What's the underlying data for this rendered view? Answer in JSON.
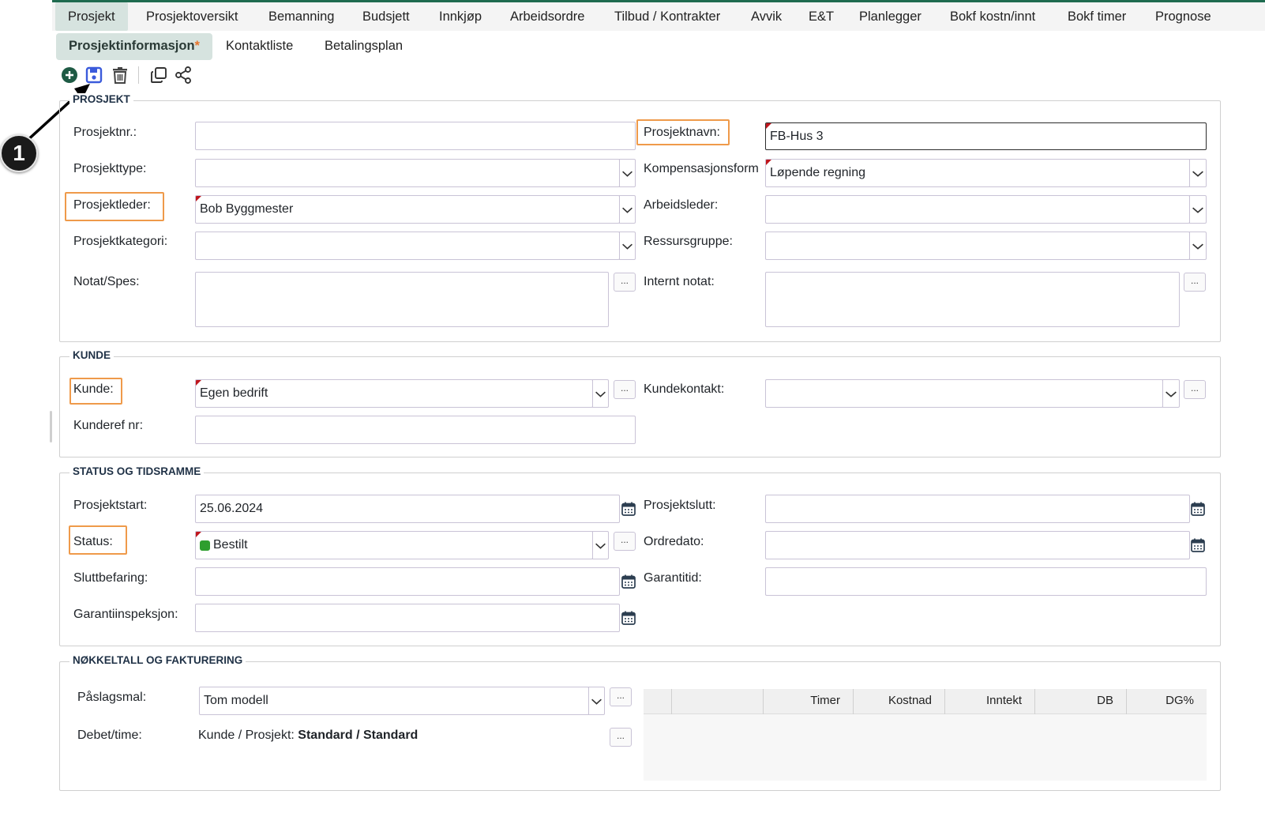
{
  "nav": {
    "tabs": [
      {
        "label": "Prosjekt"
      },
      {
        "label": "Prosjektoversikt"
      },
      {
        "label": "Bemanning"
      },
      {
        "label": "Budsjett"
      },
      {
        "label": "Innkjøp"
      },
      {
        "label": "Arbeidsordre"
      },
      {
        "label": "Tilbud / Kontrakter"
      },
      {
        "label": "Avvik"
      },
      {
        "label": "E&T"
      },
      {
        "label": "Planlegger"
      },
      {
        "label": "Bokf kostn/innt"
      },
      {
        "label": "Bokf timer"
      },
      {
        "label": "Prognose"
      }
    ],
    "subtabs": [
      {
        "label": "Prosjektinformasjon",
        "marker": "*"
      },
      {
        "label": "Kontaktliste"
      },
      {
        "label": "Betalingsplan"
      }
    ]
  },
  "toolbar": {
    "icons": [
      "add-circle-icon",
      "save-icon",
      "trash-icon",
      "copy-icon",
      "share-icon"
    ]
  },
  "annotation": {
    "badge": "1"
  },
  "sections": {
    "prosjekt": {
      "legend": "PROSJEKT",
      "prosjektnr": {
        "label": "Prosjektnr.:",
        "value": ""
      },
      "prosjektnavn": {
        "label": "Prosjektnavn:",
        "value": "FB-Hus 3"
      },
      "prosjekttype": {
        "label": "Prosjekttype:",
        "value": ""
      },
      "kompensasjonsform": {
        "label": "Kompensasjonsform",
        "value": "Løpende regning"
      },
      "prosjektleder": {
        "label": "Prosjektleder:",
        "value": "Bob Byggmester"
      },
      "arbeidsleder": {
        "label": "Arbeidsleder:",
        "value": ""
      },
      "prosjektkategori": {
        "label": "Prosjektkategori:",
        "value": ""
      },
      "ressursgruppe": {
        "label": "Ressursgruppe:",
        "value": ""
      },
      "notat": {
        "label": "Notat/Spes:",
        "value": ""
      },
      "internt_notat": {
        "label": "Internt notat:",
        "value": ""
      }
    },
    "kunde": {
      "legend": "KUNDE",
      "kunde": {
        "label": "Kunde:",
        "value": "Egen bedrift"
      },
      "kundekontakt": {
        "label": "Kundekontakt:",
        "value": ""
      },
      "kunderef": {
        "label": "Kunderef nr:",
        "value": ""
      }
    },
    "status": {
      "legend": "STATUS OG TIDSRAMME",
      "prosjektstart": {
        "label": "Prosjektstart:",
        "value": "25.06.2024"
      },
      "prosjektslutt": {
        "label": "Prosjektslutt:",
        "value": ""
      },
      "status": {
        "label": "Status:",
        "value": "Bestilt",
        "color": "#2e9e2e"
      },
      "ordredato": {
        "label": "Ordredato:",
        "value": ""
      },
      "sluttbefaring": {
        "label": "Sluttbefaring:",
        "value": ""
      },
      "garantitid": {
        "label": "Garantitid:",
        "value": ""
      },
      "garantiinspeksjon": {
        "label": "Garantiinspeksjon:",
        "value": ""
      }
    },
    "nokkeltall": {
      "legend": "NØKKELTALL OG FAKTURERING",
      "paslagsmal": {
        "label": "Påslagsmal:",
        "value": "Tom modell"
      },
      "debet": {
        "label": "Debet/time:",
        "prefix": "Kunde / Prosjekt:",
        "value": "Standard / Standard"
      },
      "table_headers": [
        "",
        "",
        "Timer",
        "Kostnad",
        "Inntekt",
        "DB",
        "DG%"
      ]
    }
  },
  "common": {
    "dots": "..."
  },
  "colors": {
    "accent": "#1e6b4f",
    "highlight": "#ef9a4a",
    "required": "#c0161d",
    "save": "#3b5bdb"
  }
}
